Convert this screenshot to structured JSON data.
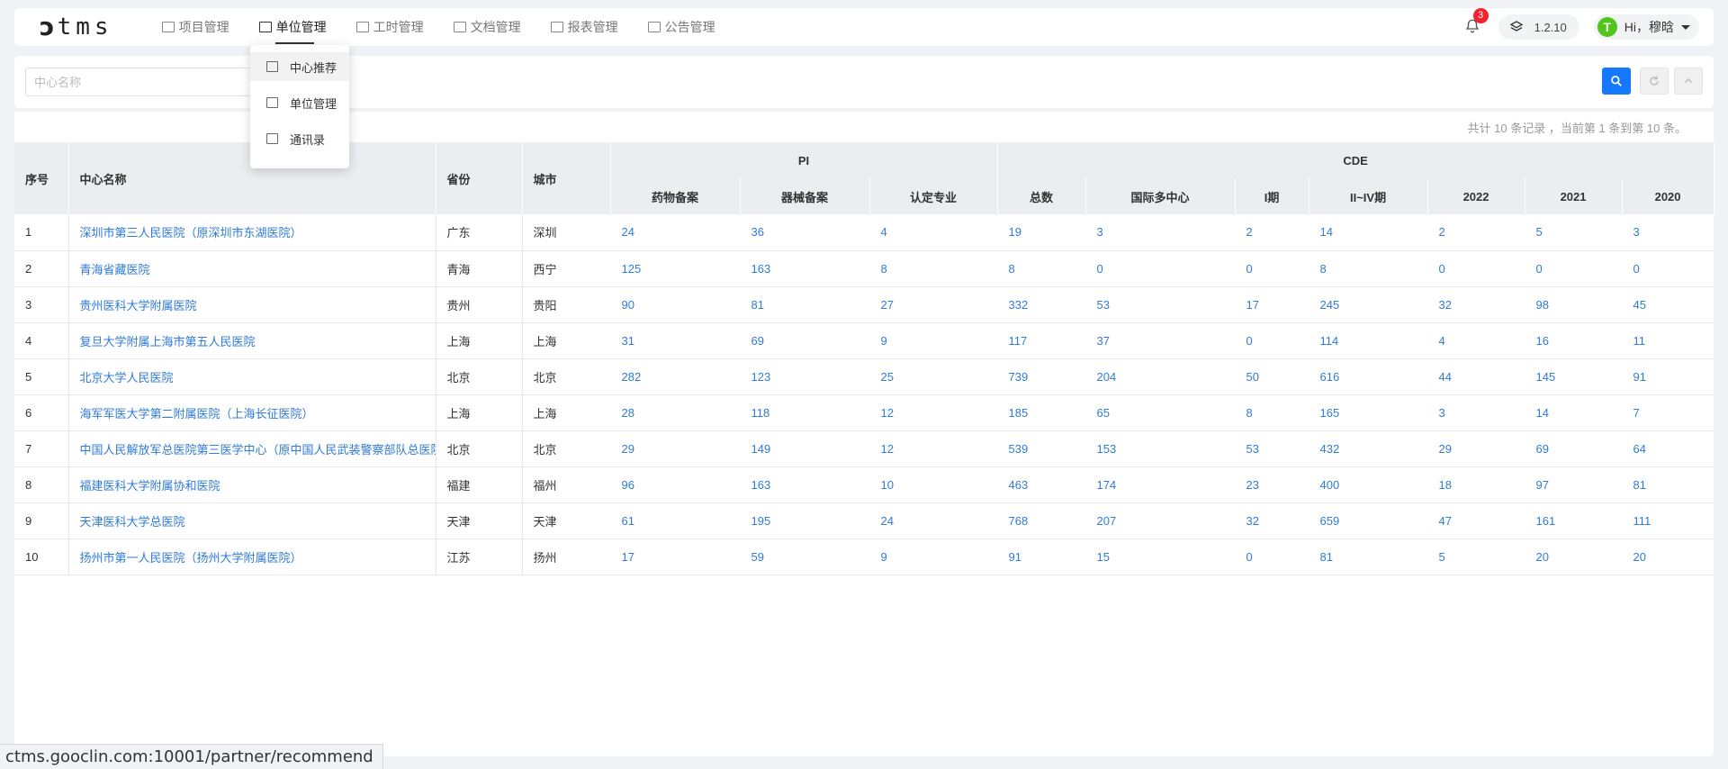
{
  "logo": {
    "mark": "ↄ",
    "text": "tms"
  },
  "nav": [
    {
      "label": "项目管理",
      "icon": "table-icon",
      "active": false
    },
    {
      "label": "单位管理",
      "icon": "building-icon",
      "active": true
    },
    {
      "label": "工时管理",
      "icon": "calendar-icon",
      "active": false
    },
    {
      "label": "文档管理",
      "icon": "folder-icon",
      "active": false
    },
    {
      "label": "报表管理",
      "icon": "report-icon",
      "active": false
    },
    {
      "label": "公告管理",
      "icon": "announcement-icon",
      "active": false
    }
  ],
  "header": {
    "notification_count": "3",
    "version": "1.2.10",
    "avatar_letter": "T",
    "greeting": "Hi，穆晗"
  },
  "dropdown": [
    {
      "label": "中心推荐",
      "icon": "recommend-icon"
    },
    {
      "label": "单位管理",
      "icon": "building-icon"
    },
    {
      "label": "通讯录",
      "icon": "contacts-icon"
    }
  ],
  "search": {
    "placeholder": "中心名称",
    "value": ""
  },
  "summary": "共计 10 条记录 ，当前第 1 条到第  10 条。",
  "table": {
    "headers": {
      "index": "序号",
      "name": "中心名称",
      "province": "省份",
      "city": "城市",
      "pi_group": "PI",
      "cde_group": "CDE",
      "pi_cols": [
        "药物备案",
        "器械备案",
        "认定专业"
      ],
      "cde_cols": [
        "总数",
        "国际多中心",
        "I期",
        "II~IV期",
        "2022",
        "2021",
        "2020"
      ]
    },
    "rows": [
      {
        "index": "1",
        "name": "深圳市第三人民医院（原深圳市东湖医院）",
        "province": "广东",
        "city": "深圳",
        "vals": [
          "24",
          "36",
          "4",
          "19",
          "3",
          "2",
          "14",
          "2",
          "5",
          "3"
        ]
      },
      {
        "index": "2",
        "name": "青海省藏医院",
        "province": "青海",
        "city": "西宁",
        "vals": [
          "125",
          "163",
          "8",
          "8",
          "0",
          "0",
          "8",
          "0",
          "0",
          "0"
        ]
      },
      {
        "index": "3",
        "name": "贵州医科大学附属医院",
        "province": "贵州",
        "city": "贵阳",
        "vals": [
          "90",
          "81",
          "27",
          "332",
          "53",
          "17",
          "245",
          "32",
          "98",
          "45"
        ]
      },
      {
        "index": "4",
        "name": "复旦大学附属上海市第五人民医院",
        "province": "上海",
        "city": "上海",
        "vals": [
          "31",
          "69",
          "9",
          "117",
          "37",
          "0",
          "114",
          "4",
          "16",
          "11"
        ]
      },
      {
        "index": "5",
        "name": "北京大学人民医院",
        "province": "北京",
        "city": "北京",
        "vals": [
          "282",
          "123",
          "25",
          "739",
          "204",
          "50",
          "616",
          "44",
          "145",
          "91"
        ]
      },
      {
        "index": "6",
        "name": "海军军医大学第二附属医院（上海长征医院）",
        "province": "上海",
        "city": "上海",
        "vals": [
          "28",
          "118",
          "12",
          "185",
          "65",
          "8",
          "165",
          "3",
          "14",
          "7"
        ]
      },
      {
        "index": "7",
        "name": "中国人民解放军总医院第三医学中心（原中国人民武装警察部队总医院）",
        "province": "北京",
        "city": "北京",
        "vals": [
          "29",
          "149",
          "12",
          "539",
          "153",
          "53",
          "432",
          "29",
          "69",
          "64"
        ]
      },
      {
        "index": "8",
        "name": "福建医科大学附属协和医院",
        "province": "福建",
        "city": "福州",
        "vals": [
          "96",
          "163",
          "10",
          "463",
          "174",
          "23",
          "400",
          "18",
          "97",
          "81"
        ]
      },
      {
        "index": "9",
        "name": "天津医科大学总医院",
        "province": "天津",
        "city": "天津",
        "vals": [
          "61",
          "195",
          "24",
          "768",
          "207",
          "32",
          "659",
          "47",
          "161",
          "111"
        ]
      },
      {
        "index": "10",
        "name": "扬州市第一人民医院（扬州大学附属医院）",
        "province": "江苏",
        "city": "扬州",
        "vals": [
          "17",
          "59",
          "9",
          "91",
          "15",
          "0",
          "81",
          "5",
          "20",
          "20"
        ]
      }
    ]
  },
  "statusbar": "ctms.gooclin.com:10001/partner/recommend",
  "colors": {
    "link": "#2f7bd8",
    "primary": "#1677ff",
    "badge": "#f5222d",
    "avatar": "#52c41a",
    "header_bg": "#ebedf0"
  }
}
